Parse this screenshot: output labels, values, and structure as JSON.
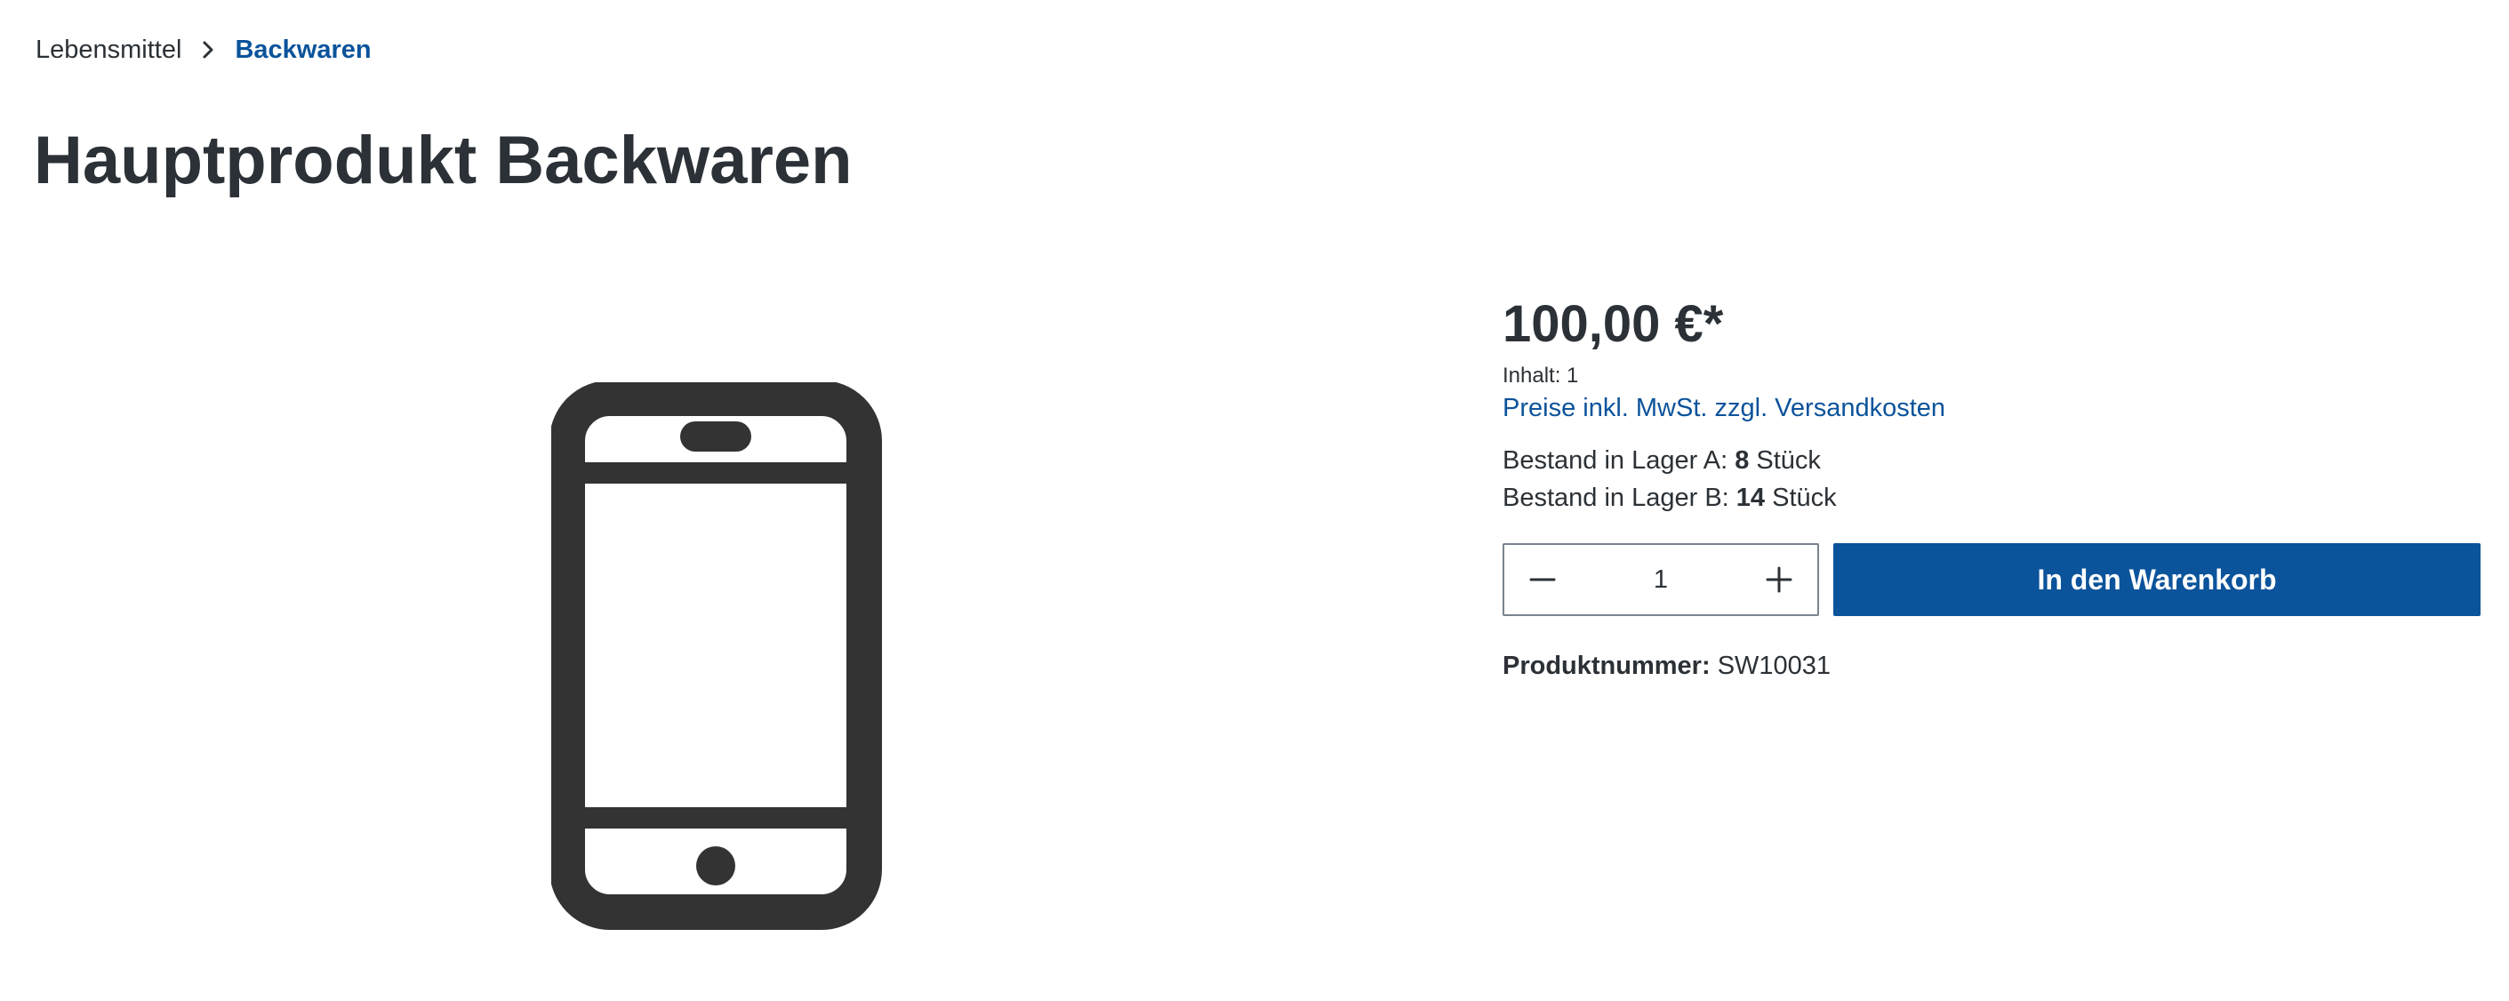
{
  "breadcrumb": {
    "items": [
      {
        "label": "Lebensmittel"
      },
      {
        "label": "Backwaren"
      }
    ]
  },
  "product": {
    "title": "Hauptprodukt Backwaren",
    "image_icon": "smartphone-icon",
    "price": "100,00 €*",
    "content": "Inhalt: 1",
    "tax_link": "Preise inkl. MwSt. zzgl. Versandkosten",
    "stock": [
      {
        "prefix": "Bestand in Lager A: ",
        "qty": "8",
        "suffix": " Stück"
      },
      {
        "prefix": "Bestand in Lager B: ",
        "qty": "14",
        "suffix": " Stück"
      }
    ],
    "quantity": "1",
    "add_to_cart_label": "In den Warenkorb",
    "product_number_label": "Produktnummer:",
    "product_number_value": "SW10031"
  },
  "colors": {
    "brand": "#0b539b",
    "text": "#2b3136",
    "border": "#798490",
    "icon": "#333333"
  }
}
